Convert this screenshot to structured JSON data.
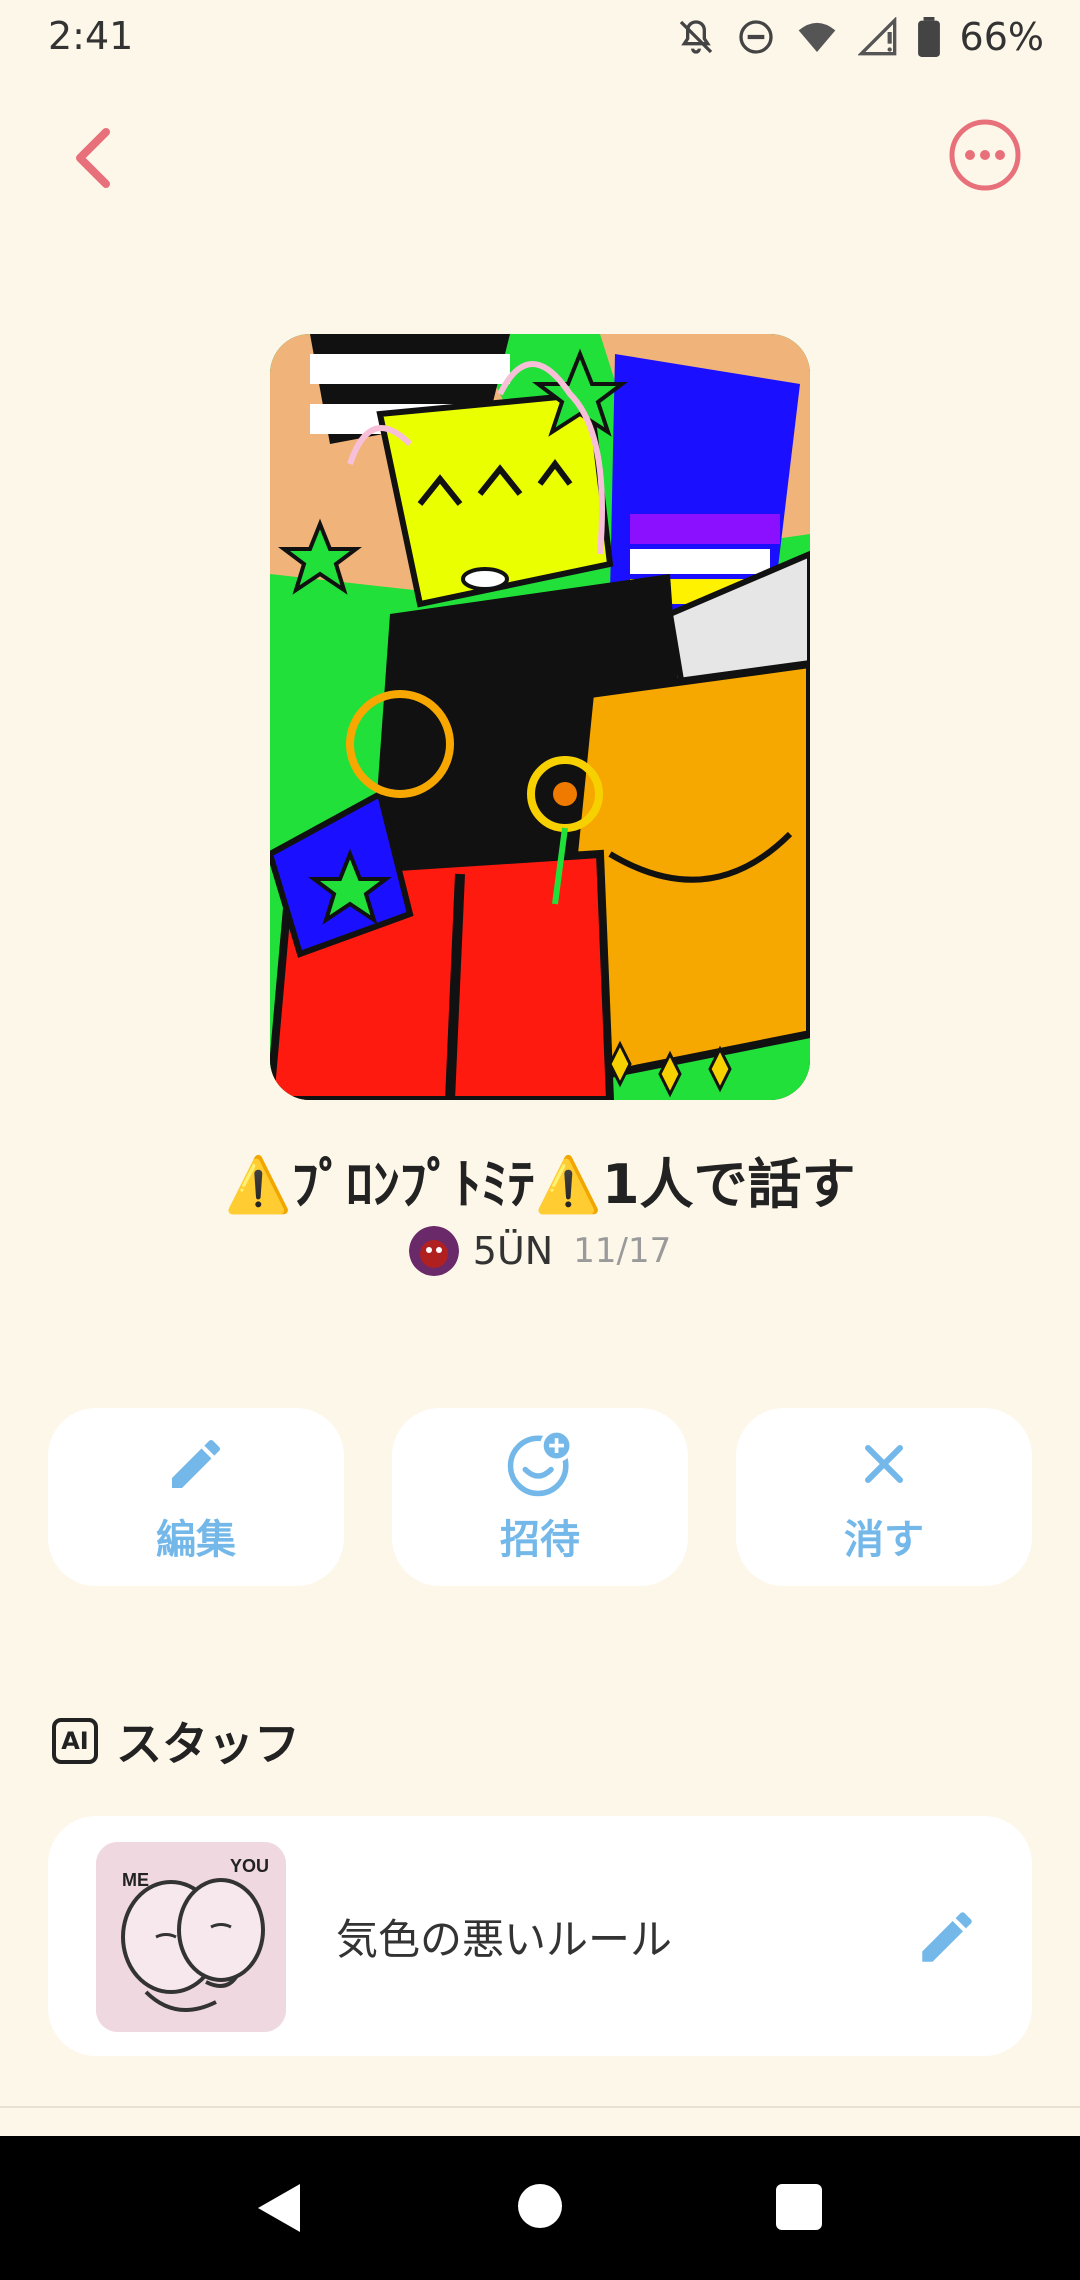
{
  "status_bar": {
    "time": "2:41",
    "battery": "66%",
    "icons": [
      "notifications-off-icon",
      "do-not-disturb-icon",
      "wifi-icon",
      "cell-signal-icon",
      "battery-icon"
    ]
  },
  "header": {
    "back_icon": "chevron-left-icon",
    "more_icon": "more-horizontal-icon"
  },
  "room": {
    "title": "⚠️ﾌﾟﾛﾝﾌﾟﾄﾐﾃ⚠️1人で話す",
    "author": "5ÜN",
    "date": "11/17"
  },
  "actions": [
    {
      "label": "編集",
      "icon": "pencil-icon"
    },
    {
      "label": "招待",
      "icon": "invite-face-icon"
    },
    {
      "label": "消す",
      "icon": "close-icon"
    }
  ],
  "staff": {
    "heading": "スタッフ",
    "badge": "AI",
    "items": [
      {
        "label": "気色の悪いルール",
        "thumb_text_left": "ME",
        "thumb_text_right": "YOU"
      }
    ]
  },
  "colors": {
    "background": "#fdf7ea",
    "accent_pink": "#e8707a",
    "action_blue": "#74b8ea",
    "card": "#ffffff"
  }
}
